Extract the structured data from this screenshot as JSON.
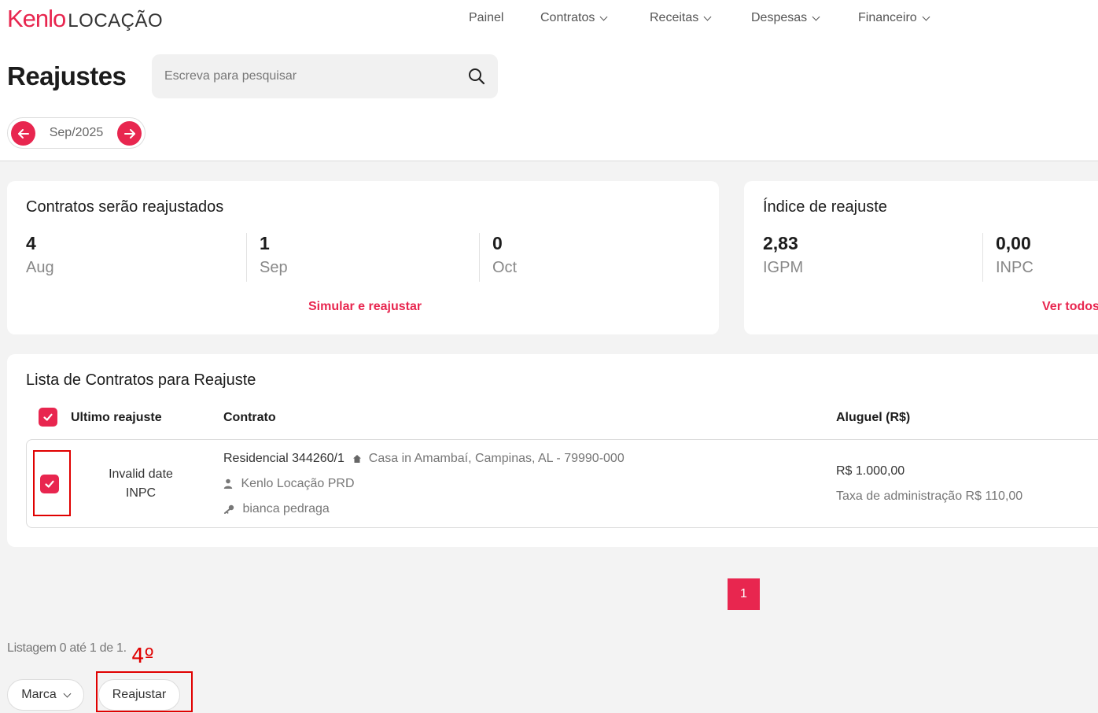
{
  "brand": {
    "logo_primary": "Kenlo",
    "logo_secondary": "LOCAÇÃO",
    "accent": "#e8264f"
  },
  "nav": {
    "items": [
      {
        "label": "Painel",
        "has_dropdown": false
      },
      {
        "label": "Contratos",
        "has_dropdown": true
      },
      {
        "label": "Receitas",
        "has_dropdown": true
      },
      {
        "label": "Despesas",
        "has_dropdown": true
      },
      {
        "label": "Financeiro",
        "has_dropdown": true
      }
    ]
  },
  "page": {
    "title": "Reajustes"
  },
  "search": {
    "placeholder": "Escreva para pesquisar",
    "value": ""
  },
  "month_nav": {
    "current": "Sep/2025"
  },
  "contracts_card": {
    "title": "Contratos serão reajustados",
    "stats": [
      {
        "value": "4",
        "label": "Aug"
      },
      {
        "value": "1",
        "label": "Sep"
      },
      {
        "value": "0",
        "label": "Oct"
      }
    ],
    "action": "Simular e reajustar"
  },
  "index_card": {
    "title": "Índice de reajuste",
    "stats": [
      {
        "value": "2,83",
        "label": "IGPM"
      },
      {
        "value": "0,00",
        "label": "INPC"
      }
    ],
    "action": "Ver todos"
  },
  "list": {
    "title": "Lista de Contratos para Reajuste",
    "headers": {
      "last_adjustment": "Ultimo reajuste",
      "contract": "Contrato",
      "rent": "Aluguel (R$)"
    },
    "select_all_checked": true,
    "rows": [
      {
        "checked": true,
        "last_date": "Invalid date",
        "index": "INPC",
        "contract_id": "Residencial 344260/1",
        "address": "Casa in Amambaí, Campinas, AL - 79990-000",
        "owner": "Kenlo Locação PRD",
        "tenant": "bianca pedraga",
        "rent": "R$ 1.000,00",
        "admin_fee": "Taxa de administração R$ 110,00"
      }
    ]
  },
  "pagination": {
    "current_page": "1",
    "listing_text": "Listagem 0 até 1 de 1."
  },
  "annotation": {
    "step": "4º"
  },
  "footer": {
    "brand_button": "Marca",
    "adjust_button": "Reajustar"
  }
}
